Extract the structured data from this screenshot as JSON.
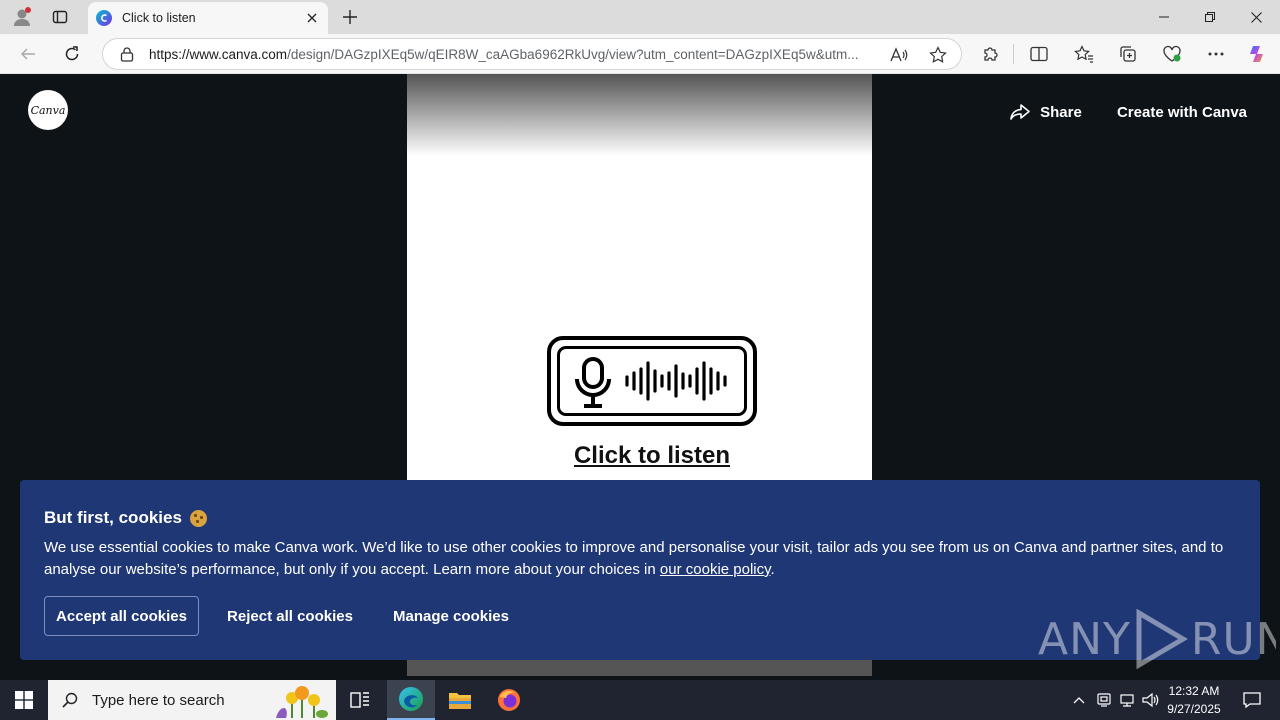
{
  "browser": {
    "tab_title": "Click to listen",
    "url_domain": "https://www.canva.com",
    "url_path": "/design/DAGzpIXEq5w/qEIR8W_caAGba6962RkUvg/view?utm_content=DAGzpIXEq5w&utm..."
  },
  "header": {
    "logo_text": "Canva",
    "share_label": "Share",
    "create_label": "Create with Canva"
  },
  "document": {
    "link_text": "Click to listen"
  },
  "cookie_banner": {
    "title": "But first, cookies",
    "body_text": "We use essential cookies to make Canva work. We’d like to use other cookies to improve and personalise your visit, tailor ads you see from us on Canva and partner sites, and to analyse our website’s performance, but only if you accept. Learn more about your choices in ",
    "policy_link": "our cookie policy",
    "body_end": ".",
    "accept_label": "Accept all cookies",
    "reject_label": "Reject all cookies",
    "manage_label": "Manage cookies"
  },
  "watermark": {
    "left": "ANY",
    "right": "RUN"
  },
  "taskbar": {
    "search_placeholder": "Type here to search",
    "time": "12:32 AM",
    "date": "9/27/2025"
  },
  "colors": {
    "cookie_bg": "#1f3875",
    "page_bg": "#0e1318",
    "taskbar_bg": "#1f2430"
  }
}
